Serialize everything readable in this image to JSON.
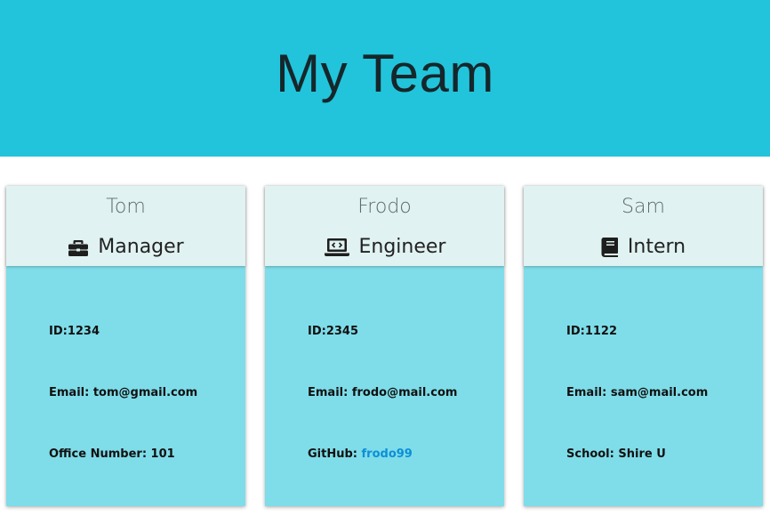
{
  "header": {
    "title": "My Team"
  },
  "cards": [
    {
      "name": "Tom",
      "role": "Manager",
      "icon": "briefcase-icon",
      "id_label": "ID:",
      "id_value": "1234",
      "email_label": "Email: ",
      "email_value": "tom@gmail.com",
      "extra_label": "Office Number: ",
      "extra_value": "101"
    },
    {
      "name": "Frodo",
      "role": "Engineer",
      "icon": "laptop-code-icon",
      "id_label": "ID:",
      "id_value": "2345",
      "email_label": "Email: ",
      "email_value": "frodo@mail.com",
      "extra_label": "GitHub: ",
      "extra_value": "frodo99"
    },
    {
      "name": "Sam",
      "role": "Intern",
      "icon": "book-icon",
      "id_label": "ID:",
      "id_value": "1122",
      "email_label": "Email: ",
      "email_value": "sam@mail.com",
      "extra_label": "School: ",
      "extra_value": "Shire U"
    }
  ],
  "colors": {
    "header_bg": "#22c4db",
    "card_body_bg": "#7edde9",
    "card_head_bg": "#e0f2f1",
    "link": "#0d8fd6"
  }
}
